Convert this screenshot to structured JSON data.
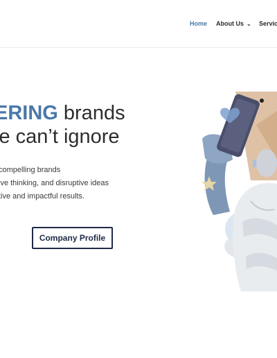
{
  "nav": {
    "items": [
      {
        "label": "Home",
        "active": true,
        "dropdown": false
      },
      {
        "label": "About Us",
        "active": false,
        "dropdown": true
      },
      {
        "label": "Services",
        "active": false,
        "dropdown": false
      }
    ]
  },
  "hero": {
    "headline_line1_highlight": "ERING",
    "headline_line1_rest": " brands",
    "headline_line2": "le can’t ignore",
    "sub_lines": [
      "compelling brands",
      "ive thinking, and disruptive ideas",
      "tive and impactful results."
    ],
    "cta_label": "Company Profile"
  },
  "colors": {
    "accent": "#4a78a8",
    "dark_navy": "#1e2a47",
    "tan": "#d9b796",
    "light_blue": "#a9c2e0"
  },
  "illustration": {
    "icons": [
      "phone-icon",
      "heart-icon",
      "star-icon",
      "hashtag-icon",
      "statue-icon"
    ]
  }
}
